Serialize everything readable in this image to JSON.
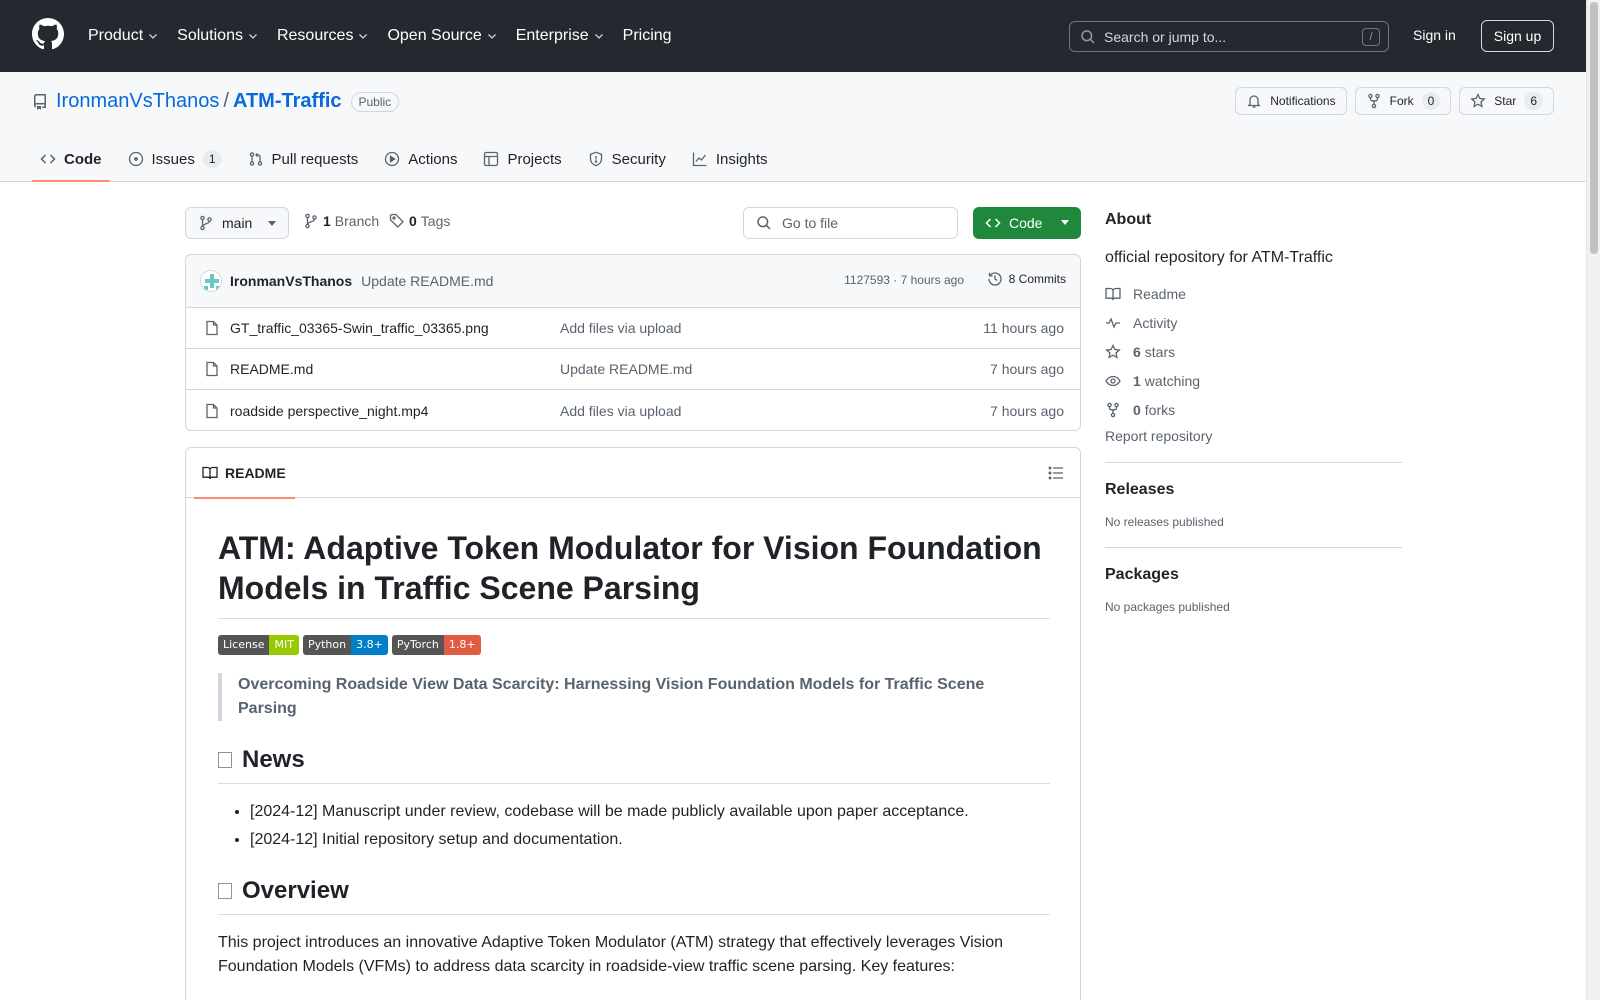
{
  "nav": {
    "items": [
      "Product",
      "Solutions",
      "Resources",
      "Open Source",
      "Enterprise",
      "Pricing"
    ],
    "search_placeholder": "Search or jump to...",
    "search_shortcut": "/",
    "signin": "Sign in",
    "signup": "Sign up"
  },
  "repo": {
    "owner": "IronmanVsThanos",
    "separator": "/",
    "name": "ATM-Traffic",
    "visibility": "Public",
    "notifications_label": "Notifications",
    "fork_label": "Fork",
    "fork_count": "0",
    "star_label": "Star",
    "star_count": "6",
    "tabs": [
      {
        "label": "Code",
        "count": ""
      },
      {
        "label": "Issues",
        "count": "1"
      },
      {
        "label": "Pull requests",
        "count": ""
      },
      {
        "label": "Actions",
        "count": ""
      },
      {
        "label": "Projects",
        "count": ""
      },
      {
        "label": "Security",
        "count": ""
      },
      {
        "label": "Insights",
        "count": ""
      }
    ]
  },
  "toolbar": {
    "branch": "main",
    "branch_count": "1",
    "branch_label": "Branch",
    "tag_count": "0",
    "tag_label": "Tags",
    "goto_placeholder": "Go to file",
    "code_label": "Code"
  },
  "commit": {
    "author": "IronmanVsThanos",
    "message": "Update README.md",
    "meta": "1127593 · 7 hours ago",
    "commits_label": "8 Commits"
  },
  "files": [
    {
      "name": "GT_traffic_03365-Swin_traffic_03365.png",
      "message": "Add files via upload",
      "time": "11 hours ago"
    },
    {
      "name": "README.md",
      "message": "Update README.md",
      "time": "7 hours ago"
    },
    {
      "name": "roadside perspective_night.mp4",
      "message": "Add files via upload",
      "time": "7 hours ago"
    }
  ],
  "readme": {
    "tab_label": "README",
    "title": "ATM: Adaptive Token Modulator for Vision Foundation Models in Traffic Scene Parsing",
    "badges": [
      {
        "left": "License",
        "right": "MIT",
        "color": "#97ca00"
      },
      {
        "left": "Python",
        "right": "3.8+",
        "color": "#007ec6"
      },
      {
        "left": "PyTorch",
        "right": "1.8+",
        "color": "#e05d44"
      }
    ],
    "quote": "Overcoming Roadside View Data Scarcity: Harnessing Vision Foundation Models for Traffic Scene Parsing",
    "news_heading": "News",
    "news_items": [
      "[2024-12] Manuscript under review, codebase will be made publicly available upon paper acceptance.",
      "[2024-12] Initial repository setup and documentation."
    ],
    "overview_heading": "Overview",
    "overview_text": "This project introduces an innovative Adaptive Token Modulator (ATM) strategy that effectively leverages Vision Foundation Models (VFMs) to address data scarcity in roadside-view traffic scene parsing. Key features:"
  },
  "sidebar": {
    "about_title": "About",
    "description": "official repository for ATM-Traffic",
    "readme_label": "Readme",
    "activity_label": "Activity",
    "stars_count": "6",
    "stars_label": "stars",
    "watching_count": "1",
    "watching_label": "watching",
    "forks_count": "0",
    "forks_label": "forks",
    "report_label": "Report repository",
    "releases_title": "Releases",
    "releases_text": "No releases published",
    "packages_title": "Packages",
    "packages_text": "No packages published"
  }
}
